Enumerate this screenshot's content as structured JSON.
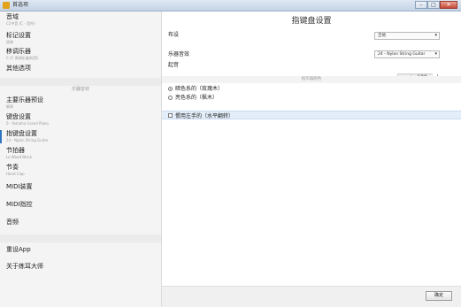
{
  "window": {
    "title": "首选项",
    "minimize_glyph": "–",
    "maximize_glyph": "□",
    "close_glyph": "✕"
  },
  "sidebar": {
    "items_top": [
      {
        "title": "音域",
        "sub": "C1中音 (C - 音符)"
      },
      {
        "title": "标记设置",
        "sub": "经典"
      },
      {
        "title": "移调乐器",
        "sub": "C (C 原调乐器/拟音)"
      },
      {
        "title": "其他选项",
        "sub": ""
      }
    ],
    "section_label": "乐器音效",
    "items_mid": [
      {
        "title": "主要乐器预设",
        "sub": "钢琴"
      },
      {
        "title": "键盘设置",
        "sub": "0 - Yamaha Grand Piano"
      },
      {
        "title": "指键盘设置",
        "sub": "24 - Nylon String Guitar"
      },
      {
        "title": "节拍器",
        "sub": "Lo Wood Block"
      },
      {
        "title": "节奏",
        "sub": "Hand Clap"
      },
      {
        "title": "MIDI装置",
        "sub": ""
      },
      {
        "title": "MIDI指控",
        "sub": ""
      },
      {
        "title": "音频",
        "sub": ""
      }
    ],
    "items_bottom": [
      {
        "title": "重设App",
        "sub": ""
      },
      {
        "title": "关于练耳大师",
        "sub": ""
      }
    ]
  },
  "main": {
    "title": "指键盘设置",
    "layout_label": "布设",
    "layout_value": "吉他",
    "instrument_label": "乐器音效",
    "instrument_value": "24 - Nylon String Guitar",
    "pitch_label": "起音",
    "pitch_value": "100",
    "minus_glyph": "—",
    "plus_glyph": "+",
    "caret_glyph": "▾",
    "section_header": "指示器颜色",
    "radio_options": [
      {
        "label": "暗色系的（玫瑰木）",
        "checked": true
      },
      {
        "label": "亮色系的（枫木）",
        "checked": false
      }
    ],
    "lefty_label": "惯用左手的（水平翻转）",
    "lefty_checked": false,
    "confirm_label": "确定"
  }
}
